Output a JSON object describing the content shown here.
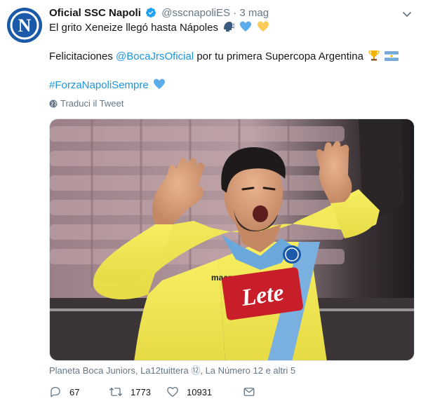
{
  "tweet": {
    "display_name": "Oficial SSC Napoli",
    "handle": "@sscnapoliES",
    "separator": "·",
    "time": "3 mag",
    "line1": "El grito Xeneize llegó hasta Nápoles",
    "line2_prefix": "Felicitaciones",
    "line2_mention": "@BocaJrsOficial",
    "line2_suffix": "por tu primera Supercopa Argentina",
    "hashtag": "#ForzaNapoliSempre",
    "translate_label": "Traduci il Tweet",
    "tagged_text": "Planeta Boca Juniors, La12tuittera ⑫, La Número 12 e altri 5",
    "media_logo_text": "Lete",
    "media_brand_text": "macron"
  },
  "actions": {
    "reply_count": "67",
    "retweet_count": "1773",
    "like_count": "10931"
  },
  "icons": {
    "avatar": "napoli-logo-icon",
    "verified": "verified-badge-icon",
    "menu": "chevron-down-icon",
    "globe": "globe-icon",
    "reply": "reply-icon",
    "retweet": "retweet-icon",
    "like": "heart-icon",
    "share": "share-icon"
  },
  "colors": {
    "link": "#1b95e0",
    "secondary_text": "#657786",
    "napoli_blue": "#1a4e9c"
  }
}
